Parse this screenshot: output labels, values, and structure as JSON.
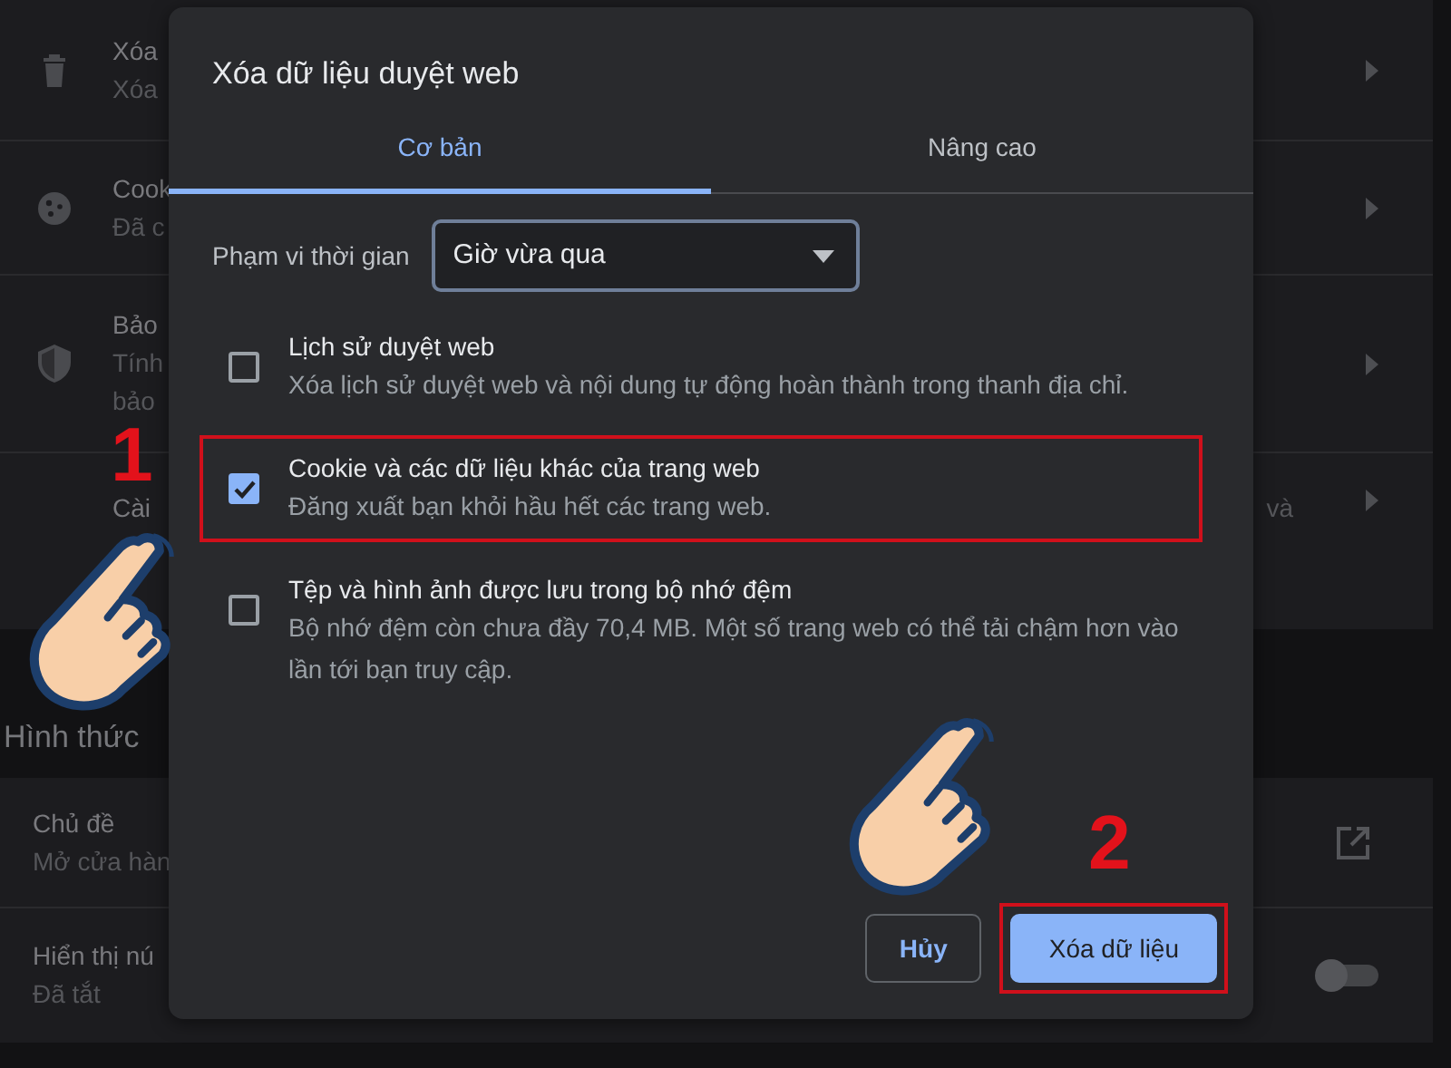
{
  "settings": {
    "privacy_rows": [
      {
        "title": "Xóa",
        "lines": [
          "Xóa"
        ]
      },
      {
        "title": "Cook",
        "lines": [
          "Đã c"
        ]
      },
      {
        "title": "Bảo",
        "lines": [
          "Tính",
          "bảo"
        ]
      },
      {
        "title": "Cài",
        "lines": [],
        "trailing_text": "và"
      }
    ],
    "section_heading": "Hình thức",
    "appearance_rows": [
      {
        "kind": "external",
        "title": "Chủ đề",
        "lines": [
          "Mở cửa hàn"
        ]
      },
      {
        "kind": "toggle",
        "title": "Hiển thị nú",
        "lines": [
          "Đã tắt"
        ],
        "on": false
      }
    ]
  },
  "dialog": {
    "title": "Xóa dữ liệu duyệt web",
    "tabs": [
      {
        "label": "Cơ bản",
        "selected": true
      },
      {
        "label": "Nâng cao",
        "selected": false
      }
    ],
    "time_range": {
      "label": "Phạm vi thời gian",
      "value": "Giờ vừa qua"
    },
    "options": [
      {
        "title": "Lịch sử duyệt web",
        "description": "Xóa lịch sử duyệt web và nội dung tự động hoàn thành trong thanh địa chỉ.",
        "checked": false,
        "highlighted": false
      },
      {
        "title": "Cookie và các dữ liệu khác của trang web",
        "description": "Đăng xuất bạn khỏi hầu hết các trang web.",
        "checked": true,
        "highlighted": true
      },
      {
        "title": "Tệp và hình ảnh được lưu trong bộ nhớ đệm",
        "description": "Bộ nhớ đệm còn chưa đầy 70,4 MB. Một số trang web có thể tải chậm hơn vào lần tới bạn truy cập.",
        "checked": false,
        "highlighted": false
      }
    ],
    "buttons": [
      {
        "label": "Hủy",
        "kind": "secondary",
        "highlighted": false
      },
      {
        "label": "Xóa dữ liệu",
        "kind": "primary",
        "highlighted": true
      }
    ]
  },
  "annotations": {
    "step_numbers": [
      "1",
      "2"
    ]
  }
}
